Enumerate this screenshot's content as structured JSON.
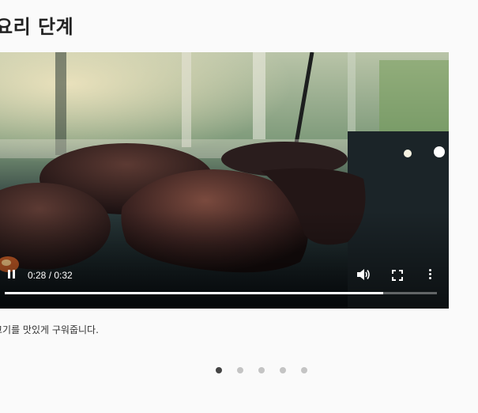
{
  "section": {
    "title": "요리 단계"
  },
  "video": {
    "current_time": "0:28",
    "duration": "0:32",
    "time_display": "0:28 / 0:32",
    "progress_fraction": 0.875,
    "state": "playing",
    "icons": {
      "play_pause": "pause-icon",
      "volume": "volume-icon",
      "fullscreen": "fullscreen-icon",
      "more": "more-vert-icon"
    }
  },
  "step": {
    "caption": "고기를 맛있게 구워줍니다."
  },
  "pagination": {
    "count": 5,
    "active_index": 0
  },
  "colors": {
    "dot_active": "#444444",
    "dot_inactive": "#c4c4c4",
    "progress_fill": "#ffffff"
  }
}
